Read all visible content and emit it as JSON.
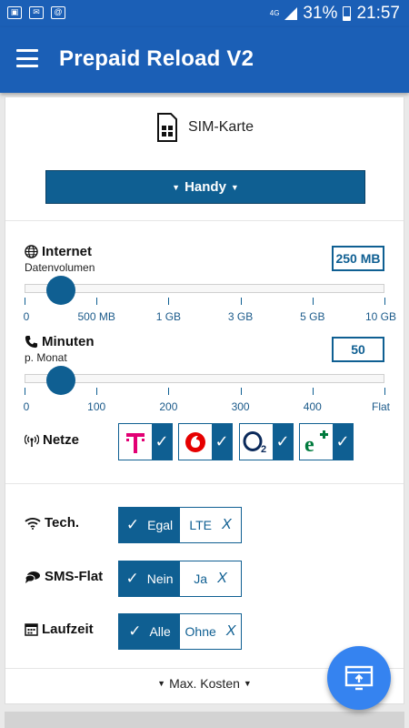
{
  "status_bar": {
    "icons": [
      "app-icon",
      "mail-icon",
      "at-icon"
    ],
    "network": "4G",
    "battery": "31%",
    "time": "21:57"
  },
  "app": {
    "title": "Prepaid Reload V2"
  },
  "sim": {
    "label": "SIM-Karte"
  },
  "device_button": {
    "label": "Handy"
  },
  "internet": {
    "title": "Internet",
    "subtitle": "Datenvolumen",
    "value": "250 MB",
    "ticks": [
      "0",
      "500 MB",
      "1 GB",
      "3 GB",
      "5 GB",
      "10 GB"
    ],
    "selected_tick_fraction": 0.1
  },
  "minutes": {
    "title": "Minuten",
    "subtitle": "p. Monat",
    "value": "50",
    "ticks": [
      "0",
      "100",
      "200",
      "300",
      "400",
      "Flat"
    ],
    "selected_tick_fraction": 0.1
  },
  "networks": {
    "title": "Netze",
    "items": [
      {
        "name": "Telekom",
        "logo": "telekom-t-icon",
        "checked": true
      },
      {
        "name": "Vodafone",
        "logo": "vodafone-icon",
        "checked": true
      },
      {
        "name": "O2",
        "logo": "o2-icon",
        "checked": true
      },
      {
        "name": "E-Plus",
        "logo": "eplus-icon",
        "checked": true
      }
    ]
  },
  "tech": {
    "title": "Tech.",
    "option_a": "Egal",
    "option_b": "LTE",
    "selected": "Egal"
  },
  "sms": {
    "title": "SMS-Flat",
    "option_a": "Nein",
    "option_b": "Ja",
    "selected": "Nein"
  },
  "duration": {
    "title": "Laufzeit",
    "option_a": "Alle",
    "option_b": "Ohne",
    "selected": "Alle"
  },
  "max_cost": {
    "label": "Max. Kosten"
  },
  "glyphs": {
    "check": "✓",
    "cross": "X"
  },
  "colors": {
    "primary": "#1b5fb6",
    "accent": "#0f5f92",
    "fab": "#3583f0",
    "telekom": "#e20074",
    "vodafone": "#e60000",
    "eplus": "#007a3d"
  }
}
